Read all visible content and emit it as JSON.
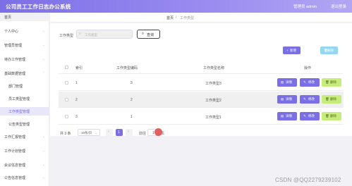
{
  "app": {
    "title": "公司员工工作日志办公系统",
    "admin_label": "管理员 admin",
    "logout_label": "退出登录"
  },
  "sidebar": {
    "items": [
      {
        "label": "首页"
      },
      {
        "label": "个人中心"
      },
      {
        "label": "管理员管理"
      },
      {
        "label": "待办工作管理"
      },
      {
        "label": "基础数据管理"
      },
      {
        "label": "部门管理"
      },
      {
        "label": "员工类型管理"
      },
      {
        "label": "工作类型管理"
      },
      {
        "label": "公告类型管理"
      },
      {
        "label": "工作汇报管理"
      },
      {
        "label": "工作计划管理"
      },
      {
        "label": "会议信息管理"
      },
      {
        "label": "公告信息管理"
      }
    ]
  },
  "breadcrumb": {
    "home": "首页",
    "separator": "/",
    "current": "工作类型"
  },
  "search": {
    "label": "工作类型",
    "placeholder": "工作类型",
    "button_label": "查询"
  },
  "toolbar": {
    "add_label": "新增",
    "delete_label": "删除"
  },
  "table": {
    "columns": [
      "索引",
      "工作类型编码",
      "工作类型名称",
      "操作"
    ],
    "rows": [
      {
        "index": "1",
        "code": "3",
        "name": "工作类型3"
      },
      {
        "index": "2",
        "code": "2",
        "name": "工作类型2"
      },
      {
        "index": "3",
        "code": "1",
        "name": "工作类型1"
      }
    ],
    "actions": {
      "detail": "详情",
      "edit": "修改",
      "delete": "删除"
    }
  },
  "pagination": {
    "total_text": "共 3 条",
    "page_size": "10条/页",
    "current_page": "1",
    "goto_label": "前往",
    "goto_value": "1",
    "page_suffix": "页"
  },
  "watermark": "CSDN @QQ2279239102",
  "colors": {
    "accent": "#7c6fe6",
    "delete_green": "#c6ec7b",
    "delete_all_blue": "#95d7f1"
  }
}
